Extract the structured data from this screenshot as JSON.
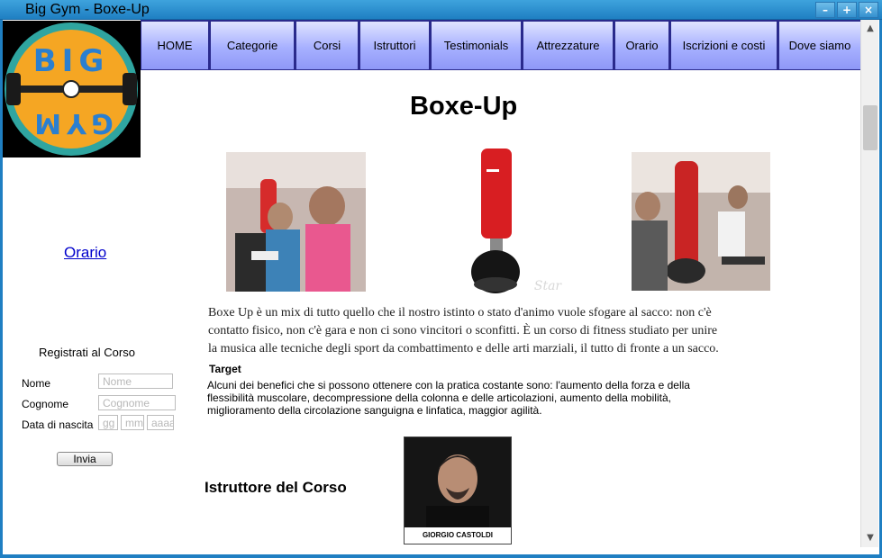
{
  "window": {
    "title": "Big Gym - Boxe-Up"
  },
  "logo": {
    "text": "BIG GYM",
    "colors": {
      "ring": "#2fa5a0",
      "fill": "#f5a623",
      "letters": "#2a7fd0"
    }
  },
  "nav": {
    "items": [
      {
        "label": "HOME",
        "width": 76
      },
      {
        "label": "Categorie",
        "width": 94
      },
      {
        "label": "Corsi",
        "width": 70
      },
      {
        "label": "Istruttori",
        "width": 78
      },
      {
        "label": "Testimonials",
        "width": 101
      },
      {
        "label": "Attrezzature",
        "width": 101
      },
      {
        "label": "Orario",
        "width": 61
      },
      {
        "label": "Iscrizioni e costi",
        "width": 119
      },
      {
        "label": "Dove siamo",
        "width": 92
      }
    ]
  },
  "sidebar": {
    "link": "Orario",
    "form": {
      "title": "Registrati al Corso",
      "name_label": "Nome",
      "name_placeholder": "Nome",
      "surname_label": "Cognome",
      "surname_placeholder": "Cognome",
      "dob_label": "Data di nascita",
      "dob_day": "gg",
      "dob_month": "mm",
      "dob_year": "aaaa",
      "submit": "Invia"
    }
  },
  "main": {
    "title": "Boxe-Up",
    "description": "Boxe Up è un mix di tutto quello che il nostro istinto o stato d'animo vuole sfogare al sacco: non c'è contatto fisico, non c'è gara e non ci sono vincitori o sconfitti. È un corso di fitness studiato per unire la musica alle tecniche degli sport da combattimento e delle arti marziali, il tutto di fronte a un sacco.",
    "target_heading": "Target",
    "target_text": "Alcuni dei benefici che si possono ottenere con la pratica costante sono: l'aumento della forza e della flessibilità muscolare, decompressione della colonna e delle articolazioni, aumento della mobilità, miglioramento della circolazione sanguigna e linfatica, maggior agilità.",
    "instructor_heading": "Istruttore del Corso",
    "instructor_name": "GIORGIO CASTOLDI"
  }
}
